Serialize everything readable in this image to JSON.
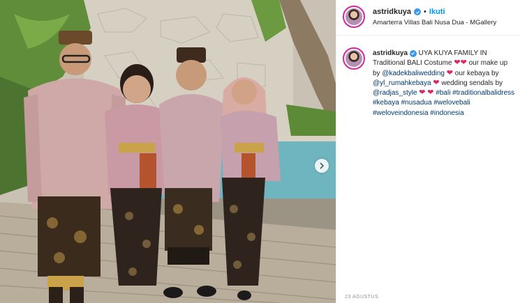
{
  "post": {
    "username": "astridkuya",
    "follow_label": "Ikuti",
    "separator": "•",
    "location": "Amarterra Villas Bali Nusa Dua - MGallery",
    "date": "23 AGUSTUS"
  },
  "caption": {
    "username": "astridkuya",
    "line1_a": "UYA KUYA FAMILY IN Traditional BALI Costume",
    "line1_b": "our make up by",
    "mention_makeup": "@kadekbaliwedding",
    "text_kebaya": "our kebaya by",
    "mention_kebaya": "@yl_rumahkebaya",
    "text_sendals": "wedding sendals by",
    "mention_sendals": "@radjas_style",
    "tags": [
      "#bali",
      "#traditionalbalidress",
      "#kebaya",
      "#nusadua",
      "#welovebali",
      "#weloveindonesia",
      "#indonesia"
    ]
  },
  "icons": {
    "verified": "verified-badge-icon",
    "heart": "red-heart-emoji",
    "next": "chevron-right-icon"
  },
  "colors": {
    "link": "#00376b",
    "follow": "#0095f6",
    "verified": "#3897f0",
    "heart": "#e0245e"
  }
}
